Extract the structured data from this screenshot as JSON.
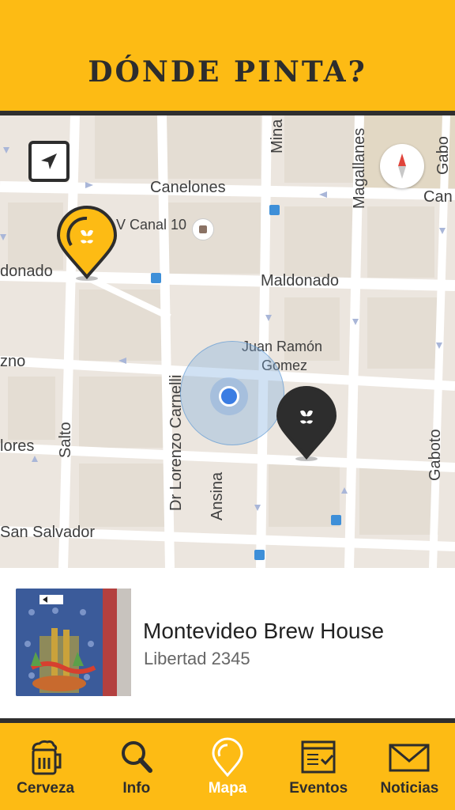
{
  "header": {
    "title": "DÓNDE PINTA?"
  },
  "map": {
    "streets": {
      "canelones": "Canelones",
      "can": "Can",
      "canal10": "V Canal 10",
      "maldonado_left": "donado",
      "maldonado": "Maldonado",
      "juan_ramon": "Juan Ramón",
      "gomez": "Gomez",
      "zno": "zno",
      "flores": "lores",
      "salto": "Salto",
      "carnelli": "Dr Lorenzo Carnelli",
      "ansina": "Ansina",
      "san_salvador": "San Salvador",
      "magallanes": "Magallanes",
      "mina": "Mina",
      "gaboto_top": "Gabo",
      "gaboto": "Gaboto"
    },
    "colors": {
      "active_pin": "#fdbb14",
      "inactive_pin": "#2d2d2d"
    },
    "icons": {
      "locate": "navigation-arrow-icon",
      "compass": "compass-icon",
      "pin_logo": "hop-leaf-icon"
    }
  },
  "card": {
    "title": "Montevideo Brew House",
    "address": "Libertad 2345"
  },
  "nav": {
    "items": [
      {
        "label": "Cerveza",
        "icon": "beer-mug-icon"
      },
      {
        "label": "Info",
        "icon": "search-icon"
      },
      {
        "label": "Mapa",
        "icon": "map-pin-icon",
        "active": true
      },
      {
        "label": "Eventos",
        "icon": "calendar-icon"
      },
      {
        "label": "Noticias",
        "icon": "mail-icon"
      }
    ]
  }
}
